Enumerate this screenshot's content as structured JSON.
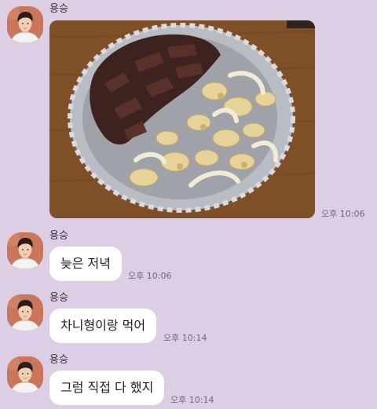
{
  "sender_name": "용승",
  "messages": [
    {
      "type": "photo",
      "time": "오후 10:06",
      "image_icon": "food-photo-icon"
    },
    {
      "type": "text",
      "text": "늦은 저녁",
      "time": "오후 10:06"
    },
    {
      "type": "text",
      "text": "차니형이랑 먹어",
      "time": "오후 10:14"
    },
    {
      "type": "text",
      "text": "그럼 직접 다 했지",
      "time": "오후 10:14"
    }
  ],
  "colors": {
    "background": "#dccfe5",
    "bubble": "#ffffff",
    "time_text": "#6e6776"
  }
}
